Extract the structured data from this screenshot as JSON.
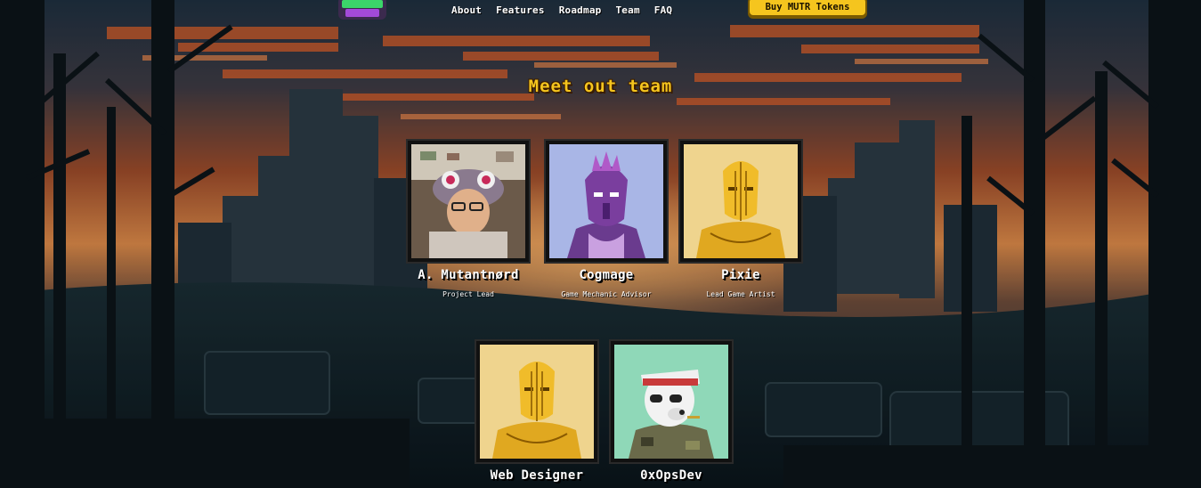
{
  "nav": {
    "links": [
      "About",
      "Features",
      "Roadmap",
      "Team",
      "FAQ"
    ],
    "buy_label": "Buy MUTR Tokens"
  },
  "team": {
    "title": "Meet out team",
    "members": [
      {
        "name": "A. Mutantnørd",
        "role": "Project Lead",
        "avatar": "photo-costume-hat"
      },
      {
        "name": "Cogmage",
        "role": "Game Mechanic Advisor",
        "avatar": "purple-alien"
      },
      {
        "name": "Pixie",
        "role": "Lead Game Artist",
        "avatar": "yellow-mutant"
      },
      {
        "name": "Web Designer",
        "role": "",
        "avatar": "yellow-mutant"
      },
      {
        "name": "0xOpsDev",
        "role": "",
        "avatar": "polar-bear-captain"
      }
    ]
  },
  "colors": {
    "accent": "#f5c51e",
    "sky_orange": "#d9652c",
    "bg_dark": "#0d1a22"
  }
}
